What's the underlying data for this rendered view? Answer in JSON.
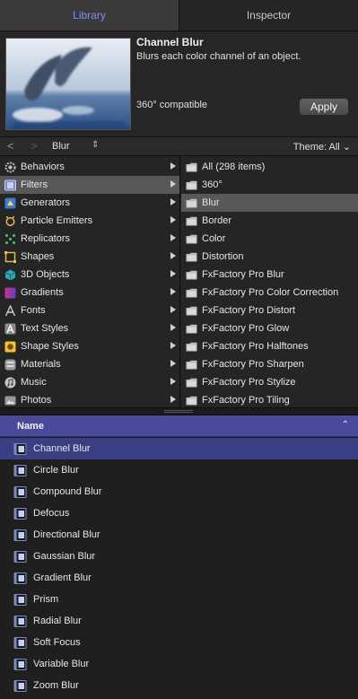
{
  "tabs": [
    {
      "label": "Library",
      "active": true
    },
    {
      "label": "Inspector",
      "active": false
    }
  ],
  "preview": {
    "title": "Channel Blur",
    "description": "Blurs each color channel of an object.",
    "compat": "360° compatible",
    "apply_label": "Apply"
  },
  "nav": {
    "back": "<",
    "forward": ">",
    "path": "Blur",
    "path_stepper": "⇕",
    "theme": "Theme: All ⌄"
  },
  "categories": [
    {
      "label": "Behaviors",
      "icon": "gear-icon"
    },
    {
      "label": "Filters",
      "icon": "filters-icon",
      "selected": true
    },
    {
      "label": "Generators",
      "icon": "generators-icon"
    },
    {
      "label": "Particle Emitters",
      "icon": "particle-emitter-icon"
    },
    {
      "label": "Replicators",
      "icon": "replicator-icon"
    },
    {
      "label": "Shapes",
      "icon": "shape-icon"
    },
    {
      "label": "3D Objects",
      "icon": "cube-icon"
    },
    {
      "label": "Gradients",
      "icon": "gradient-icon"
    },
    {
      "label": "Fonts",
      "icon": "font-icon"
    },
    {
      "label": "Text Styles",
      "icon": "text-style-icon"
    },
    {
      "label": "Shape Styles",
      "icon": "shape-style-icon"
    },
    {
      "label": "Materials",
      "icon": "material-icon"
    },
    {
      "label": "Music",
      "icon": "music-icon"
    },
    {
      "label": "Photos",
      "icon": "photos-icon"
    }
  ],
  "subcategories": [
    {
      "label": "All (298 items)"
    },
    {
      "label": "360°"
    },
    {
      "label": "Blur",
      "selected": true
    },
    {
      "label": "Border"
    },
    {
      "label": "Color"
    },
    {
      "label": "Distortion"
    },
    {
      "label": "FxFactory Pro Blur"
    },
    {
      "label": "FxFactory Pro Color Correction"
    },
    {
      "label": "FxFactory Pro Distort"
    },
    {
      "label": "FxFactory Pro Glow"
    },
    {
      "label": "FxFactory Pro Halftones"
    },
    {
      "label": "FxFactory Pro Sharpen"
    },
    {
      "label": "FxFactory Pro Stylize"
    },
    {
      "label": "FxFactory Pro Tiling"
    }
  ],
  "list": {
    "header": "Name",
    "sort_indicator": "⌃",
    "items": [
      {
        "label": "Channel Blur",
        "selected": true
      },
      {
        "label": "Circle Blur"
      },
      {
        "label": "Compound Blur"
      },
      {
        "label": "Defocus"
      },
      {
        "label": "Directional Blur"
      },
      {
        "label": "Gaussian Blur"
      },
      {
        "label": "Gradient Blur"
      },
      {
        "label": "Prism"
      },
      {
        "label": "Radial Blur"
      },
      {
        "label": "Soft Focus"
      },
      {
        "label": "Variable Blur"
      },
      {
        "label": "Zoom Blur"
      }
    ]
  },
  "colors": {
    "accent": "#4a4a9b",
    "selection": "#3a3e82",
    "tab_active_text": "#7a8cff"
  }
}
